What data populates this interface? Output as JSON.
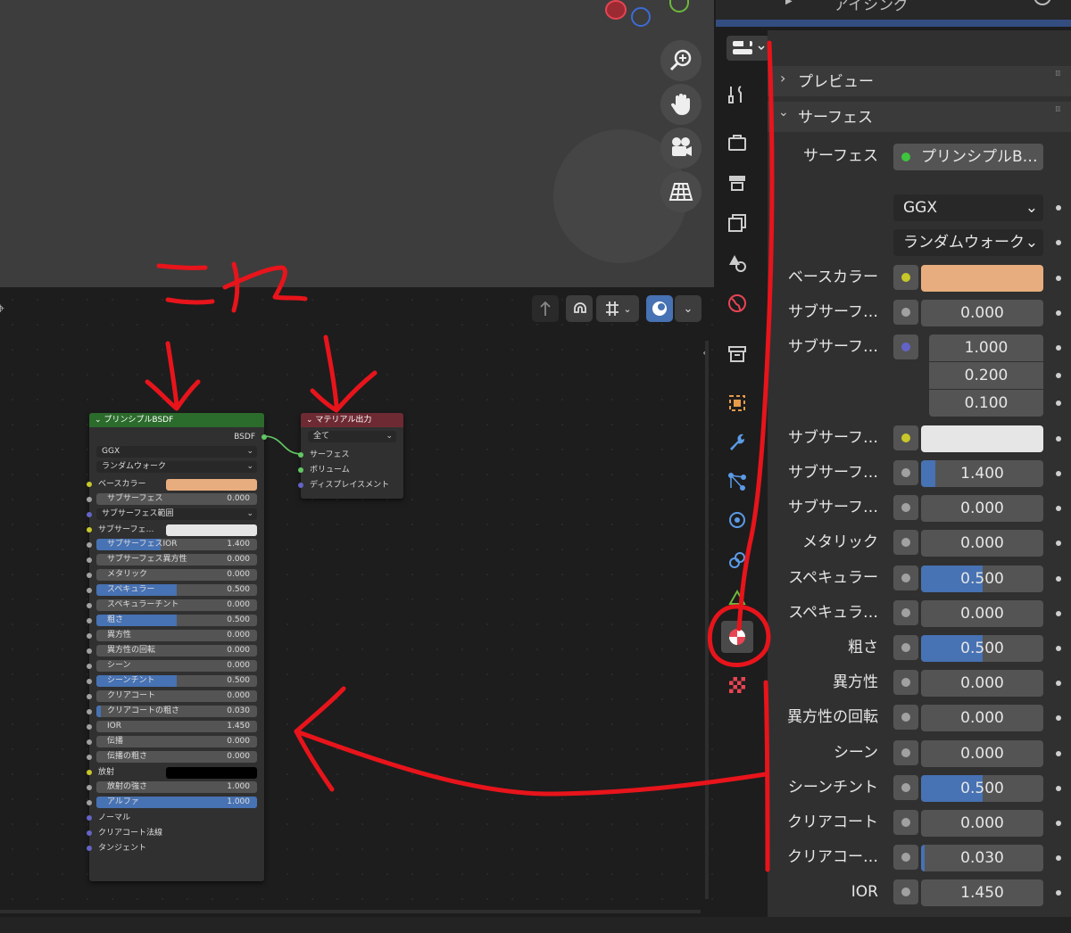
{
  "outliner": {
    "item_label": "アイシング"
  },
  "node_editor": {
    "principled": {
      "title": "プリンシプルBSDF",
      "output_label": "BSDF",
      "distribution": "GGX",
      "subsurface_method": "ランダムウォーク",
      "base_color_label": "ベースカラー",
      "base_color": "#e8ad7e",
      "subsurface_color_label": "サブサーフェ…",
      "subsurface_color": "#e6e6e6",
      "subsurface_radius_label": "サブサーフェス範囲",
      "emission_label": "放射",
      "emission_color": "#000000",
      "fields": [
        {
          "label": "サブサーフェス",
          "value": "0.000",
          "fill": 0
        },
        {
          "label": "サブサーフェスIOR",
          "value": "1.400",
          "fill": 0.4
        },
        {
          "label": "サブサーフェス異方性",
          "value": "0.000",
          "fill": 0
        },
        {
          "label": "メタリック",
          "value": "0.000",
          "fill": 0
        },
        {
          "label": "スペキュラー",
          "value": "0.500",
          "fill": 0.5
        },
        {
          "label": "スペキュラーチント",
          "value": "0.000",
          "fill": 0
        },
        {
          "label": "粗さ",
          "value": "0.500",
          "fill": 0.5
        },
        {
          "label": "異方性",
          "value": "0.000",
          "fill": 0
        },
        {
          "label": "異方性の回転",
          "value": "0.000",
          "fill": 0
        },
        {
          "label": "シーン",
          "value": "0.000",
          "fill": 0
        },
        {
          "label": "シーンチント",
          "value": "0.500",
          "fill": 0.5
        },
        {
          "label": "クリアコート",
          "value": "0.000",
          "fill": 0
        },
        {
          "label": "クリアコートの粗さ",
          "value": "0.030",
          "fill": 0.03
        },
        {
          "label": "IOR",
          "value": "1.450",
          "fill": 0
        },
        {
          "label": "伝播",
          "value": "0.000",
          "fill": 0
        },
        {
          "label": "伝播の粗さ",
          "value": "0.000",
          "fill": 0
        },
        {
          "label": "放射の強さ",
          "value": "1.000",
          "fill": 0
        },
        {
          "label": "アルファ",
          "value": "1.000",
          "fill": 1
        }
      ],
      "inputs": [
        "ノーマル",
        "クリアコート法線",
        "タンジェント"
      ]
    },
    "material_output": {
      "title": "マテリアル出力",
      "target": "全て",
      "inputs": [
        "サーフェス",
        "ボリューム",
        "ディスプレイスメント"
      ]
    }
  },
  "properties": {
    "search_placeholder": "",
    "preview_label": "プレビュー",
    "surface_panel_label": "サーフェス",
    "surface_label": "サーフェス",
    "surface_value": "プリンシプルB…",
    "distribution": "GGX",
    "subsurface_method": "ランダムウォーク",
    "base_color_label": "ベースカラー",
    "base_color": "#e8ad7e",
    "subsurface_label": "サブサーフ…",
    "subsurface_value": "0.000",
    "subsurface_radius_label": "サブサーフ…",
    "subsurface_radius": [
      "1.000",
      "0.200",
      "0.100"
    ],
    "subsurface_color_label": "サブサーフ…",
    "subsurface_color": "#e6e6e6",
    "rows": [
      {
        "label": "サブサーフ…",
        "value": "1.400",
        "fill": 0.12
      },
      {
        "label": "サブサーフ…",
        "value": "0.000",
        "fill": 0
      },
      {
        "label": "メタリック",
        "value": "0.000",
        "fill": 0
      },
      {
        "label": "スペキュラー",
        "value": "0.500",
        "fill": 0.5
      },
      {
        "label": "スペキュラ…",
        "value": "0.000",
        "fill": 0
      },
      {
        "label": "粗さ",
        "value": "0.500",
        "fill": 0.5
      },
      {
        "label": "異方性",
        "value": "0.000",
        "fill": 0
      },
      {
        "label": "異方性の回転",
        "value": "0.000",
        "fill": 0
      },
      {
        "label": "シーン",
        "value": "0.000",
        "fill": 0
      },
      {
        "label": "シーンチント",
        "value": "0.500",
        "fill": 0.5
      },
      {
        "label": "クリアコート",
        "value": "0.000",
        "fill": 0
      },
      {
        "label": "クリアコー…",
        "value": "0.030",
        "fill": 0.03
      },
      {
        "label": "IOR",
        "value": "1.450",
        "fill": 0
      }
    ]
  },
  "annotation": {
    "text": "これ",
    "color": "#e8141b"
  }
}
